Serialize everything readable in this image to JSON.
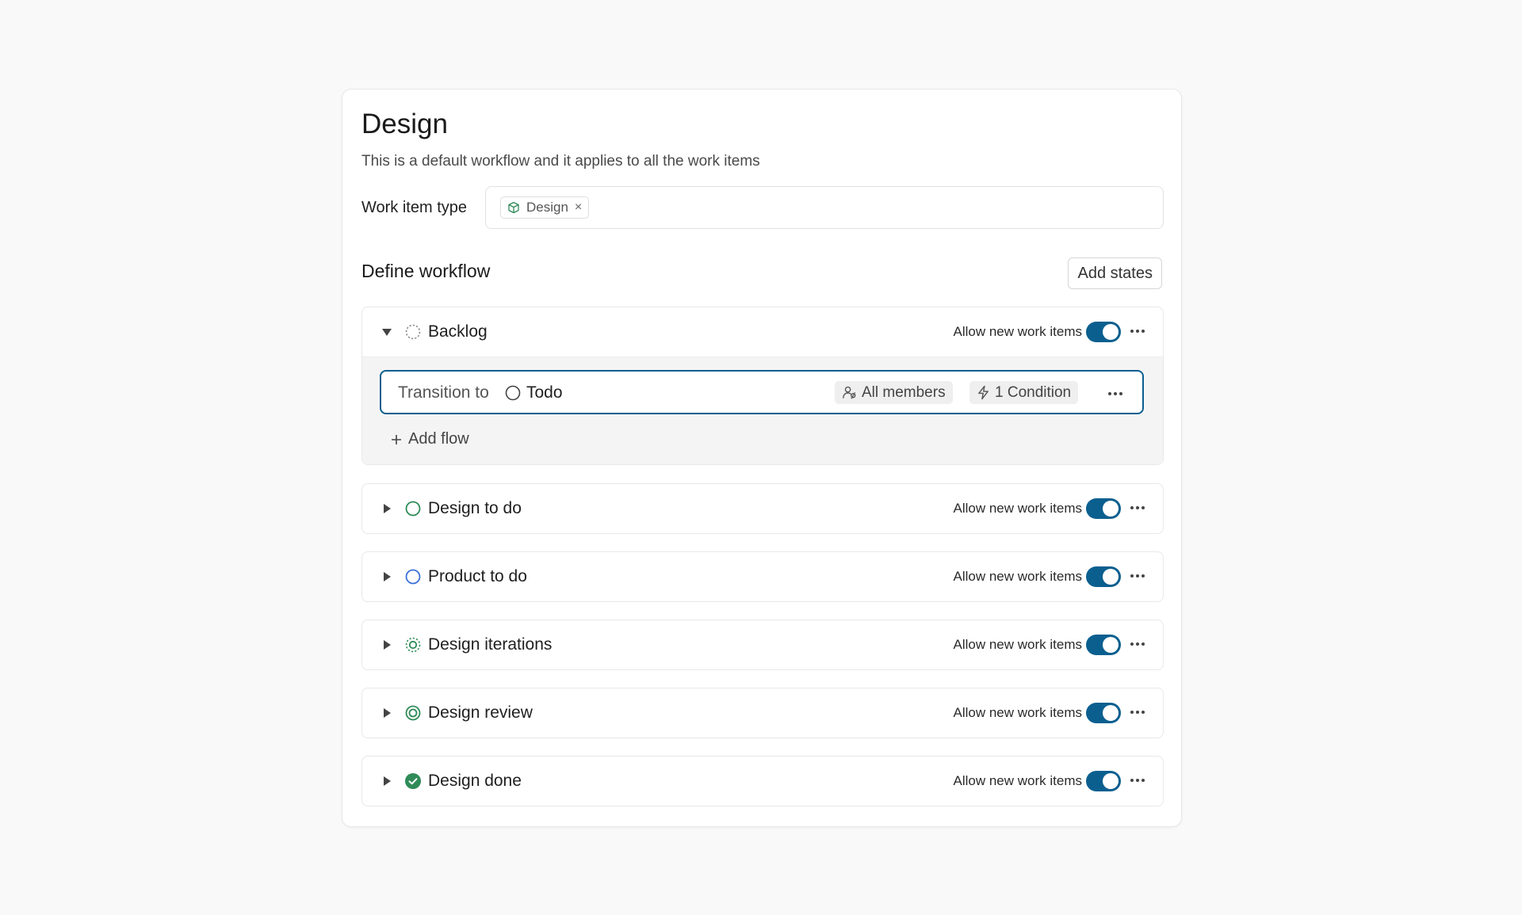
{
  "workflow": {
    "title": "Design",
    "description": "This is a default workflow and it applies to all the work items",
    "work_item_type_label": "Work item type",
    "work_item_type_chip": "Design",
    "work_item_type_chip_remove": "×"
  },
  "define": {
    "title": "Define workflow",
    "add_states_label": "Add states"
  },
  "states": [
    {
      "name": "Backlog",
      "icon": "backlog-dashed-circle-icon",
      "color": "#8a8a8a",
      "allow_label": "Allow new work items",
      "allow_enabled": true,
      "expanded": true
    },
    {
      "name": "Design to do",
      "icon": "unstarted-circle-icon",
      "color": "#2e8b57",
      "allow_label": "Allow new work items",
      "allow_enabled": true,
      "expanded": false
    },
    {
      "name": "Product to do",
      "icon": "unstarted-circle-icon",
      "color": "#3a6fd8",
      "allow_label": "Allow new work items",
      "allow_enabled": true,
      "expanded": false
    },
    {
      "name": "Design iterations",
      "icon": "in-progress-circle-icon",
      "color": "#2e8b57",
      "allow_label": "Allow new work items",
      "allow_enabled": true,
      "expanded": false
    },
    {
      "name": "Design review",
      "icon": "review-circle-icon",
      "color": "#2e8b57",
      "allow_label": "Allow new work items",
      "allow_enabled": true,
      "expanded": false
    },
    {
      "name": "Design done",
      "icon": "completed-check-icon",
      "color": "#2e8b57",
      "allow_label": "Allow new work items",
      "allow_enabled": true,
      "expanded": false
    }
  ],
  "transition": {
    "label": "Transition to",
    "target": "Todo",
    "target_icon": "empty-circle-icon",
    "members_label": "All members",
    "condition_label": "1 Condition",
    "add_flow_label": "Add flow"
  },
  "colors": {
    "accent": "#0b5f8f",
    "toggle_on": "#0b5f8f"
  }
}
